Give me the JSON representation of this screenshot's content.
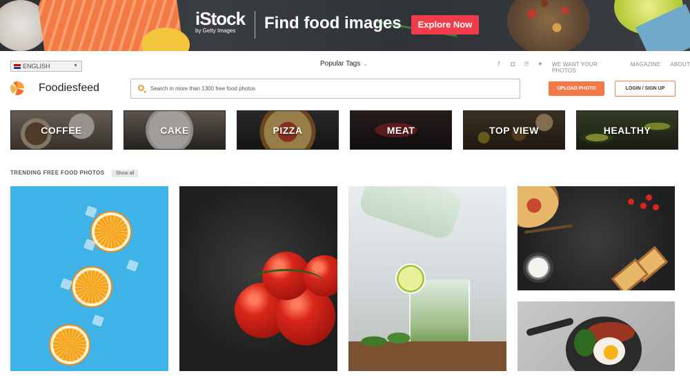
{
  "banner": {
    "brand": "iStock",
    "brand_sub": "by Getty Images",
    "headline": "Find food images",
    "cta": "Explore Now"
  },
  "topbar": {
    "language": "ENGLISH",
    "popular_tags": "Popular Tags",
    "social_icons": [
      "facebook-icon",
      "instagram-icon",
      "pinterest-icon",
      "twitter-icon"
    ],
    "links": [
      "WE WANT YOUR PHOTOS",
      "MAGAZINE",
      "ABOUT"
    ]
  },
  "header": {
    "site_name": "Foodiesfeed",
    "search_placeholder": "Search in more than 1300 free food photos",
    "upload_label": "UPLOAD PHOTO",
    "login_label": "LOGIN / SIGN UP"
  },
  "categories": [
    "COFFEE",
    "CAKE",
    "PIZZA",
    "MEAT",
    "TOP VIEW",
    "HEALTHY"
  ],
  "trending": {
    "title": "TRENDING FREE FOOD PHOTOS",
    "show_all": "Show all"
  },
  "colors": {
    "accent": "#f27a4a",
    "cta_red": "#ef3b4a",
    "search_icon": "#f0963a"
  }
}
